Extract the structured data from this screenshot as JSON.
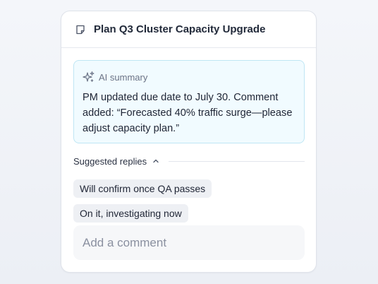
{
  "header": {
    "title": "Plan Q3 Cluster Capacity Upgrade",
    "icon": "task-icon"
  },
  "summary": {
    "icon": "sparkle-icon",
    "label": "AI summary",
    "text": "PM updated due date to July 30. Comment added: “Forecasted 40% traffic surge—please adjust capacity plan.”"
  },
  "suggestions": {
    "label": "Suggested replies",
    "toggle_icon": "chevron-up-icon",
    "replies": [
      "Will confirm once QA passes",
      "On it, investigating now"
    ]
  },
  "comment": {
    "placeholder": "Add a comment"
  },
  "colors": {
    "summary_bg": "#f1fbff",
    "summary_border": "#bfe6f4",
    "chip_bg": "#eef0f4"
  }
}
